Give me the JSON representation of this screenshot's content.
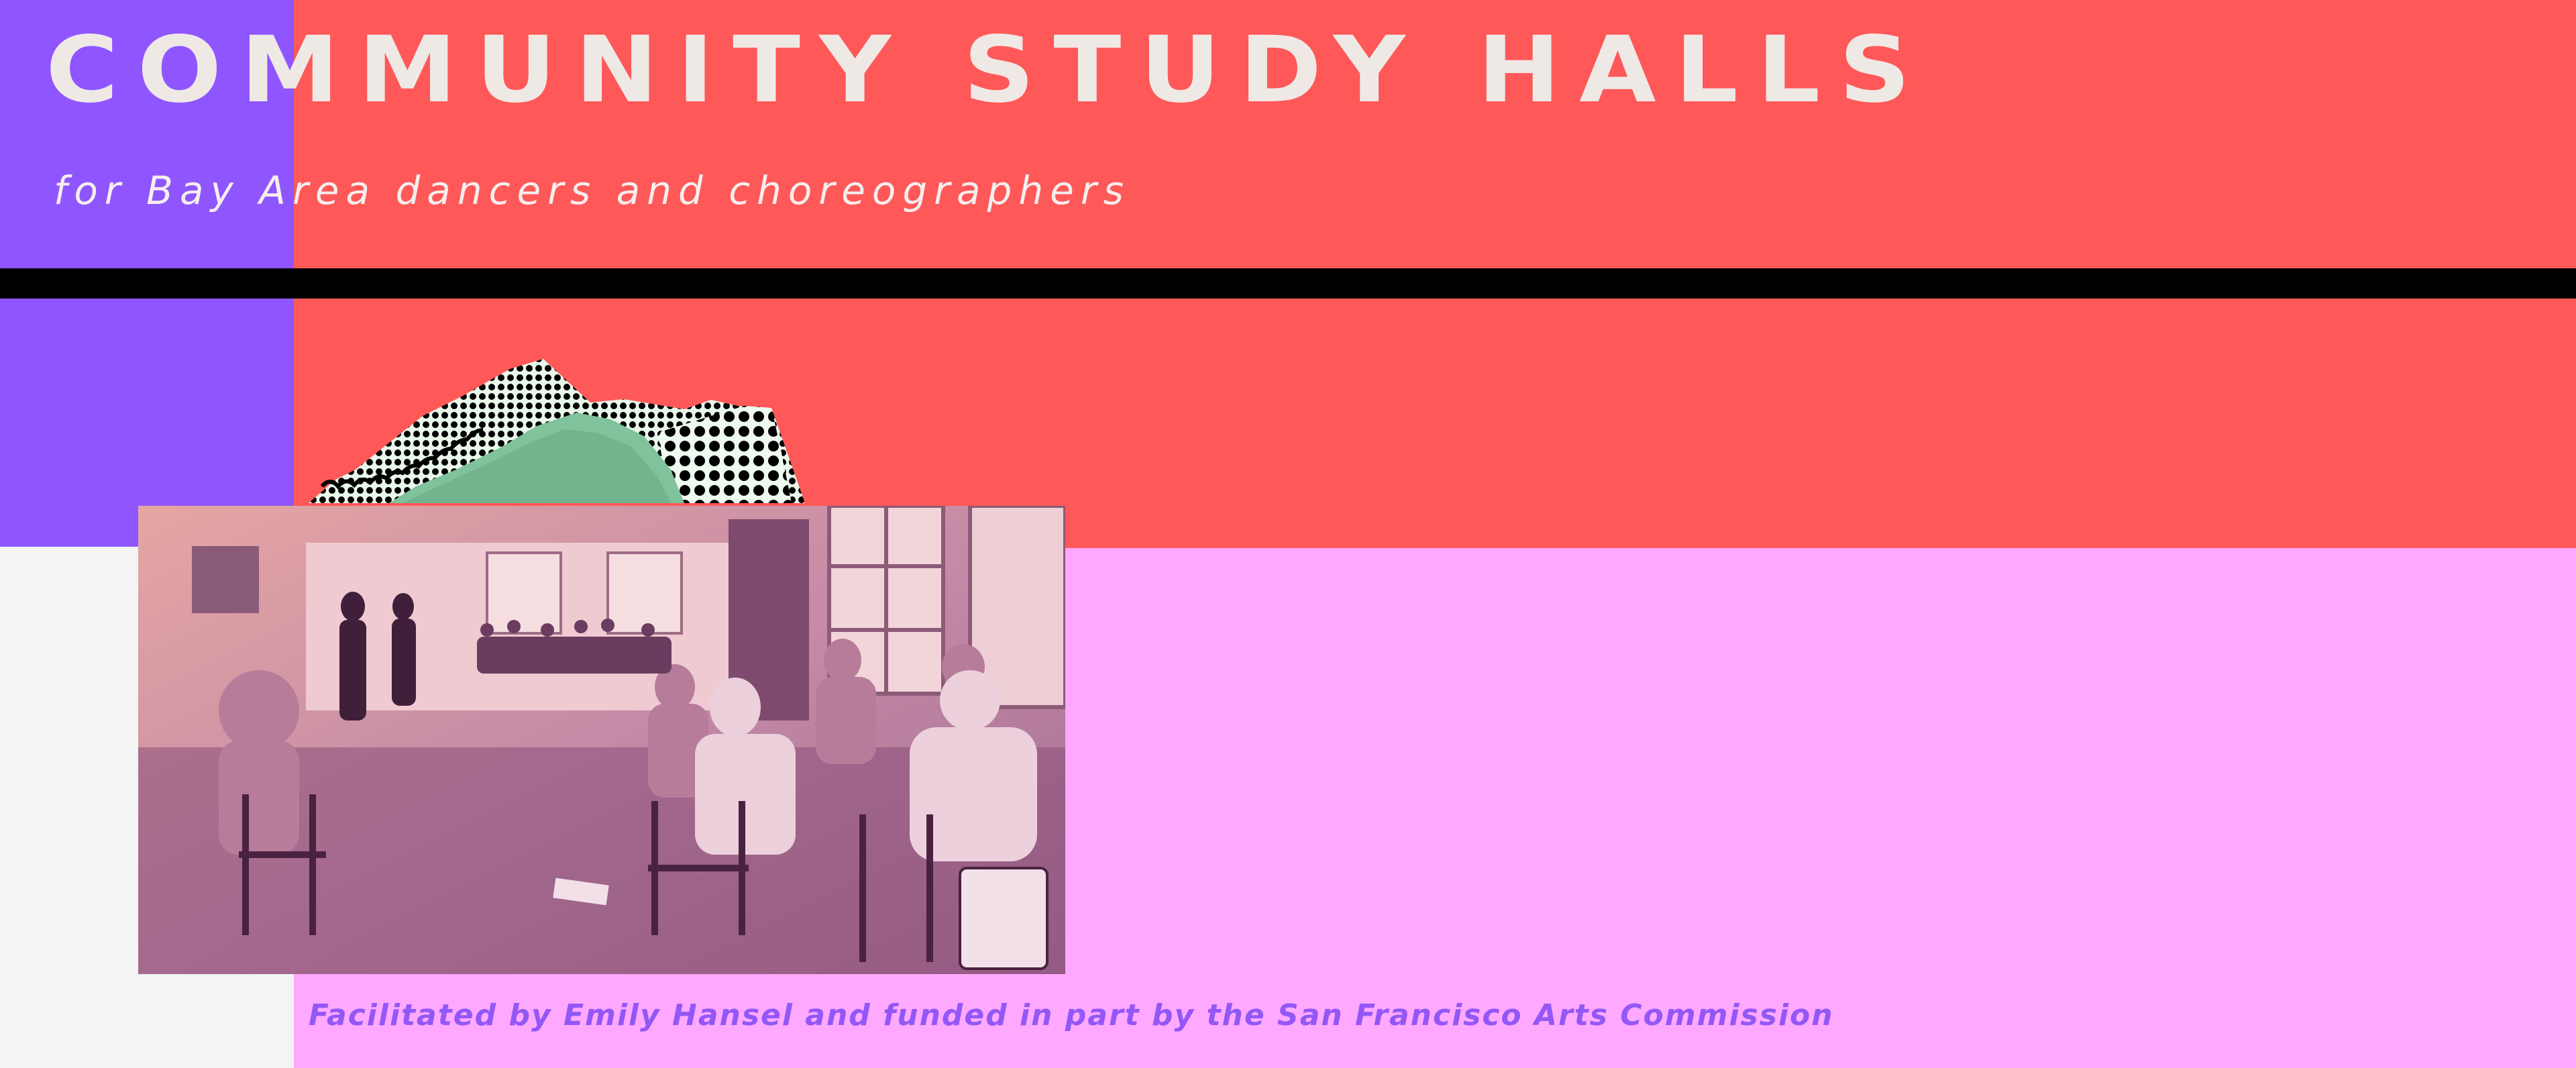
{
  "header": {
    "title": "COMMUNITY STUDY HALLS",
    "subtitle": "for Bay Area dancers and choreographers"
  },
  "footer": {
    "credit": "Facilitated by Emily Hansel and funded in part by the San Francisco Arts Commission"
  },
  "colors": {
    "purple": "#8f56ff",
    "red": "#ff5858",
    "pink": "#ffa8ff",
    "black": "#000000",
    "off_white": "#f4f4f4",
    "title_text": "#efe9e6",
    "credit_text": "#9257f5"
  },
  "images": {
    "collage": "torn-halftone-paper-collage",
    "photo": "dancers-seated-in-circle-studio-photo"
  }
}
